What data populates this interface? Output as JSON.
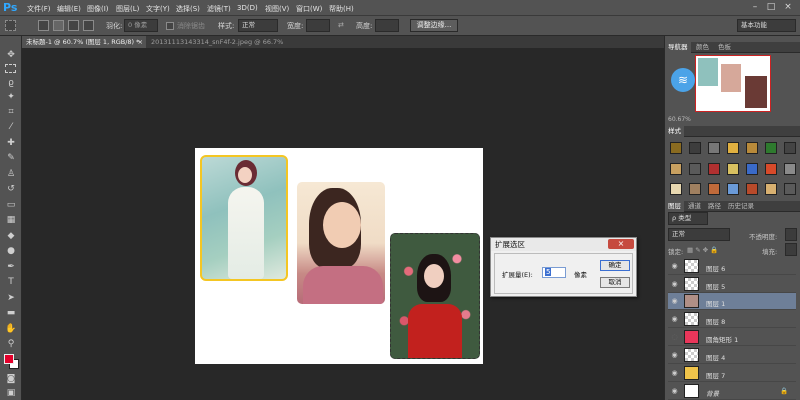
{
  "app": {
    "logo": "Ps"
  },
  "menu": [
    "文件(F)",
    "编辑(E)",
    "图像(I)",
    "图层(L)",
    "文字(Y)",
    "选择(S)",
    "滤镜(T)",
    "3D(D)",
    "视图(V)",
    "窗口(W)",
    "帮助(H)"
  ],
  "options": {
    "feather_label": "羽化:",
    "feather_value": "0 像素",
    "antialias_label": "消除锯齿",
    "style_label": "样式:",
    "style_value": "正常",
    "width_label": "宽度:",
    "height_label": "高度:",
    "refine_edge_button": "调整边缘...",
    "workspace": "基本功能"
  },
  "tabs": [
    {
      "label": "未标题-1 @ 60.7% (图层 1, RGB/8) *",
      "close": "×"
    },
    {
      "label": "20131113143314_snF4f-2.jpeg @ 66.7%(RGB/8)",
      "close": "×"
    }
  ],
  "dialog": {
    "title": "扩展选区",
    "close": "×",
    "expand_label": "扩展量(E):",
    "expand_value": "5",
    "unit": "像素",
    "ok_button": "确定",
    "cancel_button": "取消"
  },
  "navigator": {
    "tabs": [
      "导航器",
      "颜色",
      "色板"
    ],
    "zoom": "60.67%"
  },
  "styles_panel": {
    "tab": "样式"
  },
  "layers_panel": {
    "tabs": [
      "图层",
      "通道",
      "路径",
      "历史记录"
    ],
    "filter_label": "ρ 类型",
    "blend_mode": "正常",
    "opacity_label": "不透明度:",
    "lock_label": "锁定:",
    "fill_label": "填充:",
    "layers": [
      {
        "name": "图层 6",
        "selected": false
      },
      {
        "name": "图层 5",
        "selected": false
      },
      {
        "name": "图层 1",
        "selected": true
      },
      {
        "name": "图层 8",
        "selected": false
      },
      {
        "name": "圆角矩形 1",
        "selected": false
      },
      {
        "name": "图层 4",
        "selected": false
      },
      {
        "name": "图层 7",
        "selected": false
      },
      {
        "name": "背景",
        "selected": false
      }
    ]
  },
  "colors": {
    "foreground": "#e4002b",
    "background": "#ffffff",
    "selected_layer": "#6e7f98",
    "ps_blue": "#31a8ff",
    "photo_frame_yellow": "#f4c623"
  }
}
